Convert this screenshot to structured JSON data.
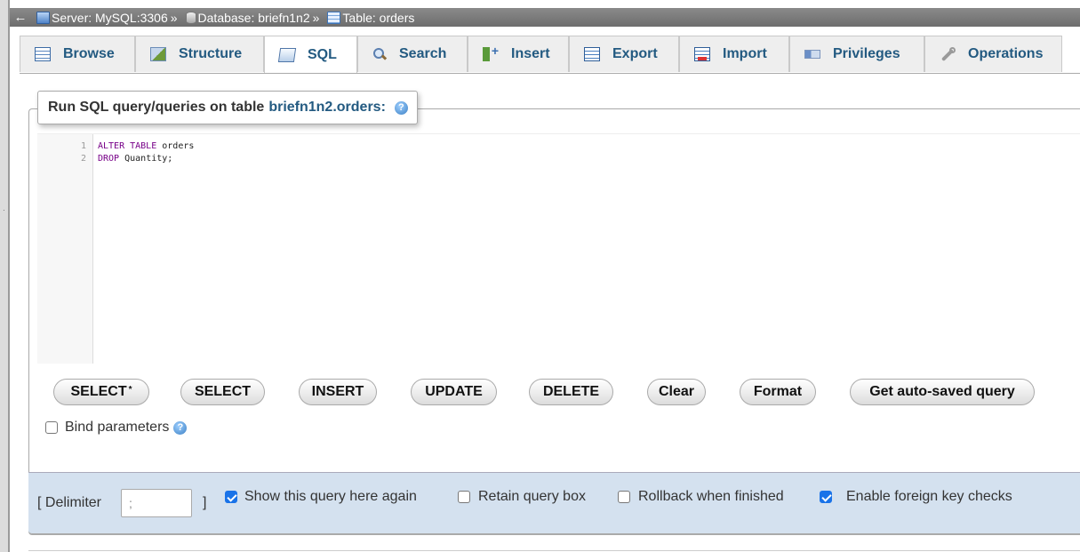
{
  "breadcrumb": {
    "back_icon": "left-arrow-icon",
    "server": "Server: MySQL:3306",
    "separator": "»",
    "database": "Database: briefn1n2",
    "table": "Table: orders"
  },
  "tabs": [
    {
      "label": "Browse",
      "icon": "browse-icon"
    },
    {
      "label": "Structure",
      "icon": "structure-icon"
    },
    {
      "label": "SQL",
      "icon": "sql-icon",
      "active": true
    },
    {
      "label": "Search",
      "icon": "search-icon"
    },
    {
      "label": "Insert",
      "icon": "insert-icon"
    },
    {
      "label": "Export",
      "icon": "export-icon"
    },
    {
      "label": "Import",
      "icon": "import-icon"
    },
    {
      "label": "Privileges",
      "icon": "privileges-icon"
    },
    {
      "label": "Operations",
      "icon": "operations-icon"
    }
  ],
  "query_panel": {
    "title_prefix": "Run SQL query/queries on table",
    "table_name": "briefn1n2.orders:",
    "help_glyph": "?"
  },
  "editor": {
    "lines": [
      {
        "num": "1",
        "keyword": "ALTER TABLE",
        "rest": " orders"
      },
      {
        "num": "2",
        "keyword": "DROP",
        "rest": " Quantity;"
      }
    ]
  },
  "sql_buttons": {
    "select_star": "SELECT",
    "select_star_sup": "*",
    "select": "SELECT",
    "insert": "INSERT",
    "update": "UPDATE",
    "delete": "DELETE",
    "clear": "Clear",
    "format": "Format",
    "auto_saved": "Get auto-saved query"
  },
  "bind_parameters": {
    "label": "Bind parameters",
    "checked": false
  },
  "options": {
    "delimiter_open": "[ Delimiter",
    "delimiter_value": ";",
    "delimiter_close": "]",
    "show_query_again": {
      "label": "Show this query here again",
      "checked": true
    },
    "retain_query_box": {
      "label": "Retain query box",
      "checked": false
    },
    "rollback_when_finished": {
      "label": "Rollback when finished",
      "checked": false
    },
    "foreign_key_checks": {
      "label": "Enable foreign key checks",
      "checked": true
    }
  },
  "colors": {
    "link_blue": "#235a81",
    "option_bar_bg": "#d4e1ef",
    "checkbox_blue": "#1a73e8",
    "sql_keyword": "#770088"
  }
}
